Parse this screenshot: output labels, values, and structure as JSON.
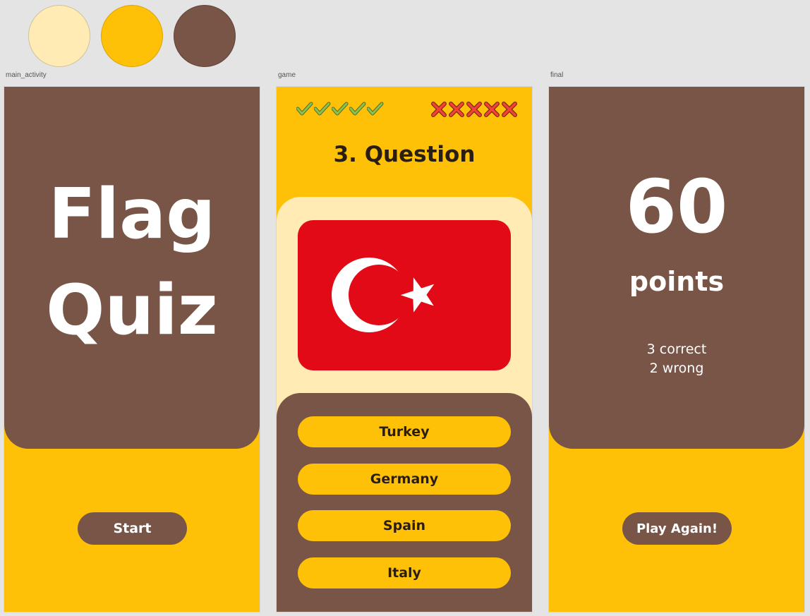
{
  "palette": {
    "light": "#ffebb3",
    "accent": "#ffc107",
    "brown": "#795548",
    "flag_red": "#e30a17",
    "check_green": "#8bc34a",
    "cross_red": "#f44336"
  },
  "screens": {
    "main": {
      "label": "main_activity",
      "title_line1": "Flag",
      "title_line2": "Quiz",
      "start_label": "Start"
    },
    "game": {
      "label": "game",
      "correct_icons": [
        "check-icon",
        "check-icon",
        "check-icon",
        "check-icon",
        "check-icon"
      ],
      "wrong_icons": [
        "cross-icon",
        "cross-icon",
        "cross-icon",
        "cross-icon",
        "cross-icon"
      ],
      "question": "3. Question",
      "flag": "turkey-flag",
      "answers": [
        "Turkey",
        "Germany",
        "Spain",
        "Italy"
      ]
    },
    "final": {
      "label": "final",
      "score": "60",
      "points_label": "points",
      "correct_text": "3 correct",
      "wrong_text": "2 wrong",
      "play_again_label": "Play Again!"
    }
  }
}
